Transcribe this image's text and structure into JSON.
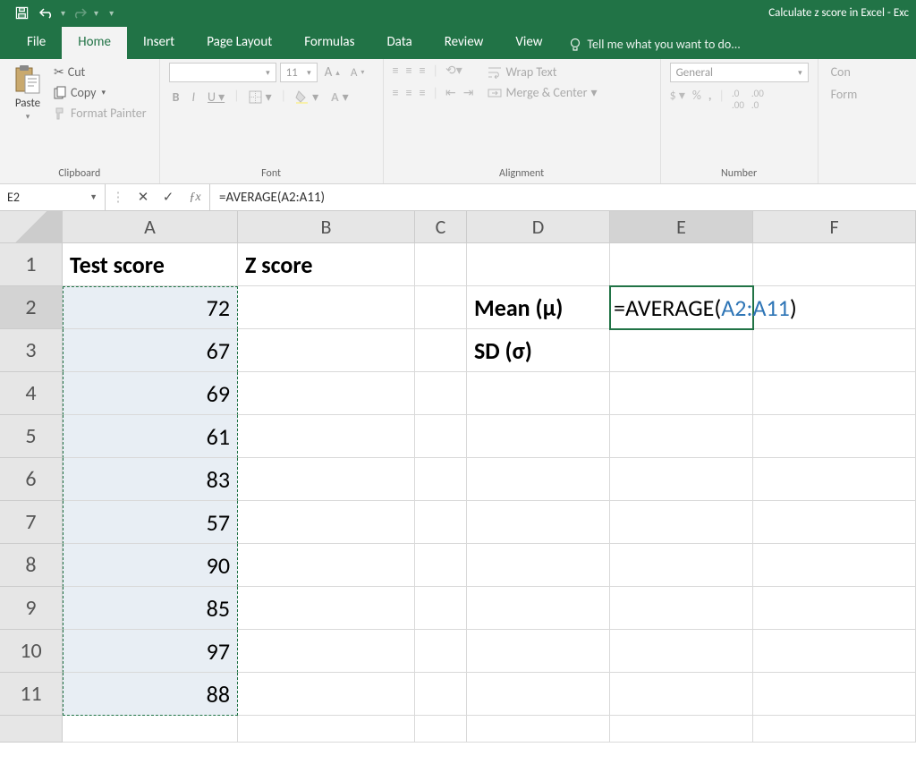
{
  "app": {
    "title": "Calculate z score in Excel - Exc"
  },
  "tabs": {
    "file": "File",
    "home": "Home",
    "insert": "Insert",
    "pagelayout": "Page Layout",
    "formulas": "Formulas",
    "data": "Data",
    "review": "Review",
    "view": "View",
    "tellme": "Tell me what you want to do..."
  },
  "ribbon": {
    "clipboard": {
      "paste": "Paste",
      "cut": "Cut",
      "copy": "Copy",
      "formatpainter": "Format Painter",
      "label": "Clipboard"
    },
    "font": {
      "face": "",
      "size": "11",
      "label": "Font"
    },
    "alignment": {
      "wrap": "Wrap Text",
      "merge": "Merge & Center",
      "label": "Alignment"
    },
    "number": {
      "format": "General",
      "label": "Number"
    },
    "styles": {
      "cond": "Con",
      "heading2": "Form"
    }
  },
  "namebox": "E2",
  "formula_bar": "=AVERAGE(A2:A11)",
  "columns": [
    "A",
    "B",
    "C",
    "D",
    "E",
    "F"
  ],
  "cells": {
    "A1": "Test score",
    "B1": "Z score",
    "A2": "72",
    "A3": "67",
    "A4": "69",
    "A5": "61",
    "A6": "83",
    "A7": "57",
    "A8": "90",
    "A9": "85",
    "A10": "97",
    "A11": "88",
    "D2": "Mean (μ)",
    "D3": "SD (σ)",
    "E2_prefix": "=AVERAGE(",
    "E2_ref": "A2:A11",
    "E2_suffix": ")"
  }
}
